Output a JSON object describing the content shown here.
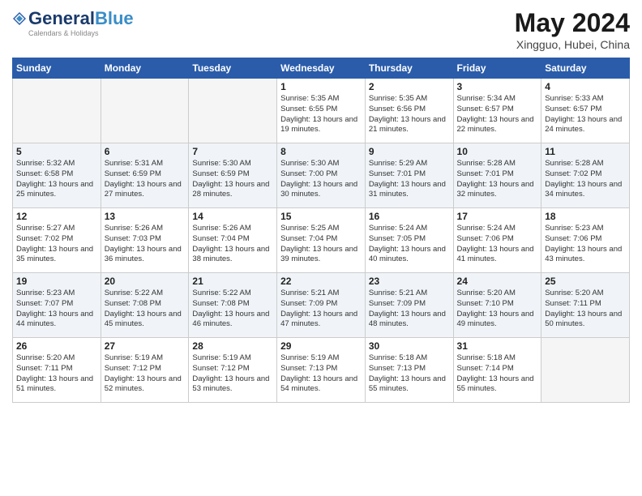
{
  "header": {
    "logo_general": "General",
    "logo_blue": "Blue",
    "month_year": "May 2024",
    "location": "Xingguo, Hubei, China"
  },
  "weekdays": [
    "Sunday",
    "Monday",
    "Tuesday",
    "Wednesday",
    "Thursday",
    "Friday",
    "Saturday"
  ],
  "weeks": [
    [
      {
        "day": "",
        "info": ""
      },
      {
        "day": "",
        "info": ""
      },
      {
        "day": "",
        "info": ""
      },
      {
        "day": "1",
        "info": "Sunrise: 5:35 AM\nSunset: 6:55 PM\nDaylight: 13 hours\nand 19 minutes."
      },
      {
        "day": "2",
        "info": "Sunrise: 5:35 AM\nSunset: 6:56 PM\nDaylight: 13 hours\nand 21 minutes."
      },
      {
        "day": "3",
        "info": "Sunrise: 5:34 AM\nSunset: 6:57 PM\nDaylight: 13 hours\nand 22 minutes."
      },
      {
        "day": "4",
        "info": "Sunrise: 5:33 AM\nSunset: 6:57 PM\nDaylight: 13 hours\nand 24 minutes."
      }
    ],
    [
      {
        "day": "5",
        "info": "Sunrise: 5:32 AM\nSunset: 6:58 PM\nDaylight: 13 hours\nand 25 minutes."
      },
      {
        "day": "6",
        "info": "Sunrise: 5:31 AM\nSunset: 6:59 PM\nDaylight: 13 hours\nand 27 minutes."
      },
      {
        "day": "7",
        "info": "Sunrise: 5:30 AM\nSunset: 6:59 PM\nDaylight: 13 hours\nand 28 minutes."
      },
      {
        "day": "8",
        "info": "Sunrise: 5:30 AM\nSunset: 7:00 PM\nDaylight: 13 hours\nand 30 minutes."
      },
      {
        "day": "9",
        "info": "Sunrise: 5:29 AM\nSunset: 7:01 PM\nDaylight: 13 hours\nand 31 minutes."
      },
      {
        "day": "10",
        "info": "Sunrise: 5:28 AM\nSunset: 7:01 PM\nDaylight: 13 hours\nand 32 minutes."
      },
      {
        "day": "11",
        "info": "Sunrise: 5:28 AM\nSunset: 7:02 PM\nDaylight: 13 hours\nand 34 minutes."
      }
    ],
    [
      {
        "day": "12",
        "info": "Sunrise: 5:27 AM\nSunset: 7:02 PM\nDaylight: 13 hours\nand 35 minutes."
      },
      {
        "day": "13",
        "info": "Sunrise: 5:26 AM\nSunset: 7:03 PM\nDaylight: 13 hours\nand 36 minutes."
      },
      {
        "day": "14",
        "info": "Sunrise: 5:26 AM\nSunset: 7:04 PM\nDaylight: 13 hours\nand 38 minutes."
      },
      {
        "day": "15",
        "info": "Sunrise: 5:25 AM\nSunset: 7:04 PM\nDaylight: 13 hours\nand 39 minutes."
      },
      {
        "day": "16",
        "info": "Sunrise: 5:24 AM\nSunset: 7:05 PM\nDaylight: 13 hours\nand 40 minutes."
      },
      {
        "day": "17",
        "info": "Sunrise: 5:24 AM\nSunset: 7:06 PM\nDaylight: 13 hours\nand 41 minutes."
      },
      {
        "day": "18",
        "info": "Sunrise: 5:23 AM\nSunset: 7:06 PM\nDaylight: 13 hours\nand 43 minutes."
      }
    ],
    [
      {
        "day": "19",
        "info": "Sunrise: 5:23 AM\nSunset: 7:07 PM\nDaylight: 13 hours\nand 44 minutes."
      },
      {
        "day": "20",
        "info": "Sunrise: 5:22 AM\nSunset: 7:08 PM\nDaylight: 13 hours\nand 45 minutes."
      },
      {
        "day": "21",
        "info": "Sunrise: 5:22 AM\nSunset: 7:08 PM\nDaylight: 13 hours\nand 46 minutes."
      },
      {
        "day": "22",
        "info": "Sunrise: 5:21 AM\nSunset: 7:09 PM\nDaylight: 13 hours\nand 47 minutes."
      },
      {
        "day": "23",
        "info": "Sunrise: 5:21 AM\nSunset: 7:09 PM\nDaylight: 13 hours\nand 48 minutes."
      },
      {
        "day": "24",
        "info": "Sunrise: 5:20 AM\nSunset: 7:10 PM\nDaylight: 13 hours\nand 49 minutes."
      },
      {
        "day": "25",
        "info": "Sunrise: 5:20 AM\nSunset: 7:11 PM\nDaylight: 13 hours\nand 50 minutes."
      }
    ],
    [
      {
        "day": "26",
        "info": "Sunrise: 5:20 AM\nSunset: 7:11 PM\nDaylight: 13 hours\nand 51 minutes."
      },
      {
        "day": "27",
        "info": "Sunrise: 5:19 AM\nSunset: 7:12 PM\nDaylight: 13 hours\nand 52 minutes."
      },
      {
        "day": "28",
        "info": "Sunrise: 5:19 AM\nSunset: 7:12 PM\nDaylight: 13 hours\nand 53 minutes."
      },
      {
        "day": "29",
        "info": "Sunrise: 5:19 AM\nSunset: 7:13 PM\nDaylight: 13 hours\nand 54 minutes."
      },
      {
        "day": "30",
        "info": "Sunrise: 5:18 AM\nSunset: 7:13 PM\nDaylight: 13 hours\nand 55 minutes."
      },
      {
        "day": "31",
        "info": "Sunrise: 5:18 AM\nSunset: 7:14 PM\nDaylight: 13 hours\nand 55 minutes."
      },
      {
        "day": "",
        "info": ""
      }
    ]
  ]
}
